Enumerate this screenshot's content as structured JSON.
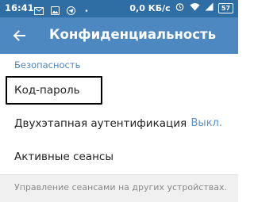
{
  "status_bar": {
    "time": "16:41",
    "net_speed": "0,0 КБ/с",
    "battery": "57",
    "bg_color": "#2f6ea5"
  },
  "app_bar": {
    "title": "Конфиденциальность",
    "back_icon": "arrow-left-icon",
    "bg_color": "#4e88c0"
  },
  "section": {
    "header": "Безопасность",
    "header_color": "#4f86b8",
    "items": [
      {
        "label": "Код-пароль",
        "value": ""
      },
      {
        "label": "Двухэтапная аутентификация",
        "value": "Выкл."
      },
      {
        "label": "Активные сеансы",
        "value": ""
      }
    ],
    "footer": "Управление сеансами на других устройствах."
  }
}
